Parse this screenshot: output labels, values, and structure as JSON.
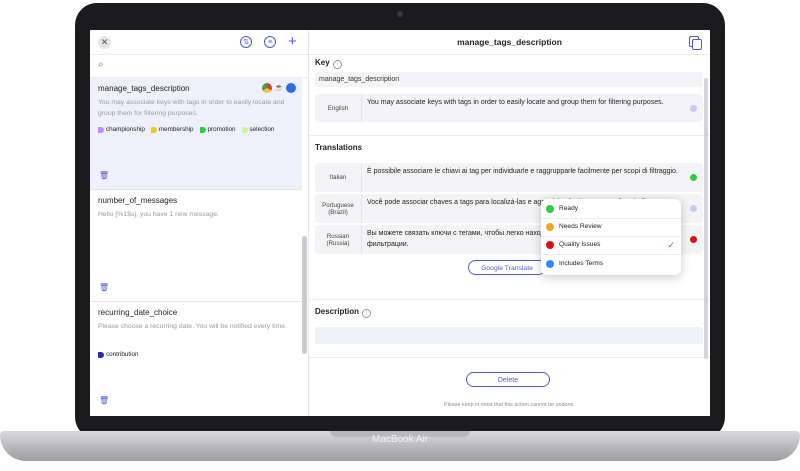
{
  "device": {
    "brand_label": "MacBook Air"
  },
  "left_pane": {
    "search_placeholder": "",
    "entries": [
      {
        "title": "manage_tags_description",
        "description": "You may associate keys with tags in order to easily locate and group them for filtering purposes.",
        "tags": [
          {
            "label": "championship",
            "color": "#c48af5"
          },
          {
            "label": "membership",
            "color": "#f5c518"
          },
          {
            "label": "promotion",
            "color": "#2ecc40"
          },
          {
            "label": "selection",
            "color": "#c8f5a0"
          }
        ],
        "browser_icons": [
          "chrome-icon",
          "java-icon",
          "apple-icon"
        ]
      },
      {
        "title": "number_of_messages",
        "description": "Hello [%1$s], you have 1 new message.",
        "tags": []
      },
      {
        "title": "recurring_date_choice",
        "description": "Please choose a recurring date. You will be notified every time.",
        "tags": [
          {
            "label": "contribution",
            "color": "#2a2ab8"
          }
        ]
      }
    ]
  },
  "right_pane": {
    "title": "manage_tags_description",
    "key_label": "Key",
    "key_value": "manage_tags_description",
    "source": {
      "language": "English",
      "text": "You may associate keys with tags in order to easily locate and group them for filtering purposes."
    },
    "translations_label": "Translations",
    "translations": [
      {
        "language": "Italian",
        "text": "È possibile associare le chiavi ai tag per individuarle e raggrupparle facilmente per scopi di filtraggio.",
        "status_color": "#2ecc40"
      },
      {
        "language": "Portuguese (Brazil)",
        "text": "Você pode associar chaves a tags para localizá-las e agrupá-las facilmente para fins de filtragem.",
        "status_color": "#c5cbf0"
      },
      {
        "language": "Russian (Russia)",
        "text": "Вы можете связать ключи с тегами, чтобы легко находить и группировать их для целей фильтрации.",
        "status_color": "#e01010"
      }
    ],
    "google_translate_label": "Google Translate",
    "description_label": "Description",
    "delete_label": "Delete",
    "warning": "Please keep in mind that this action cannot be undone."
  },
  "status_menu": {
    "items": [
      {
        "label": "Ready",
        "color": "#2ecc40",
        "checked": false
      },
      {
        "label": "Needs Review",
        "color": "#f5a623",
        "checked": false
      },
      {
        "label": "Quality Issues",
        "color": "#e01010",
        "checked": true
      },
      {
        "label": "Includes Terms",
        "color": "#2d8cf0",
        "checked": false
      }
    ],
    "check_glyph": "✓"
  }
}
